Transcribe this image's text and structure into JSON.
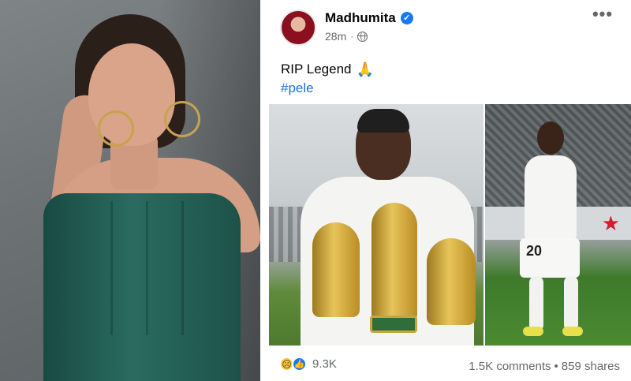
{
  "post": {
    "author": "Madhumita",
    "verified": true,
    "time": "28m",
    "visibility_icon": "globe-icon",
    "more_icon": "more-options-icon",
    "more_label": "•••",
    "caption": "RIP Legend",
    "caption_emoji": "🙏",
    "hashtag": "#pele"
  },
  "photos": {
    "left": {
      "number_on_shirt": ""
    },
    "right": {
      "shirt_number": "20"
    }
  },
  "reactions": {
    "icons": [
      "sad-reaction-icon",
      "like-reaction-icon"
    ],
    "count": "9.3K"
  },
  "engagement": {
    "comments": "1.5K comments",
    "separator": "•",
    "shares": "859 shares"
  },
  "colors": {
    "link": "#216fdb",
    "verified": "#1877f2",
    "meta_text": "#65676b",
    "dress": "#1f5a50"
  }
}
